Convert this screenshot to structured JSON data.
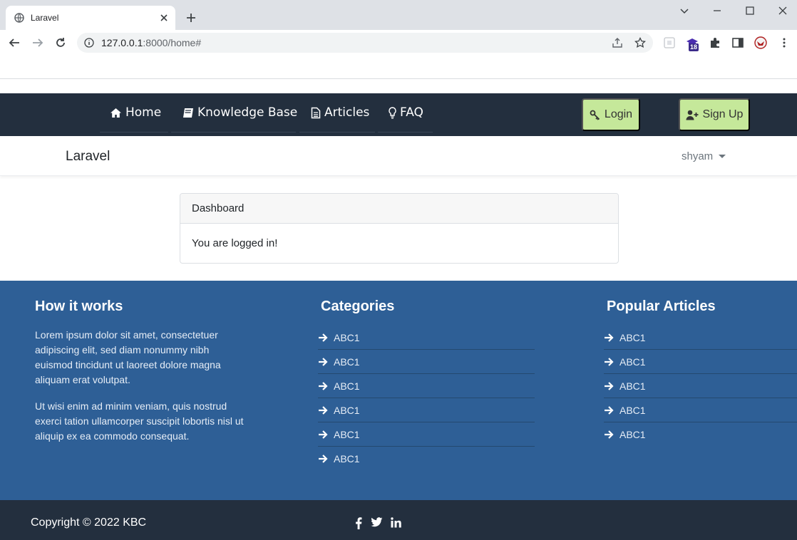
{
  "browser": {
    "tab_title": "Laravel",
    "url_host": "127.0.0.1",
    "url_rest": ":8000/home#",
    "extension_badge": "18"
  },
  "topnav": {
    "links": [
      {
        "label": "Home",
        "icon": "home-icon"
      },
      {
        "label": "Knowledge Base",
        "icon": "book-icon"
      },
      {
        "label": "Articles",
        "icon": "file-icon"
      },
      {
        "label": "FAQ",
        "icon": "lightbulb-icon"
      }
    ],
    "login_label": "Login",
    "signup_label": "Sign Up",
    "accent": "#c5e89a",
    "background": "#232f3e"
  },
  "appbar": {
    "brand": "Laravel",
    "user": "shyam"
  },
  "card": {
    "header": "Dashboard",
    "body": "You are logged in!"
  },
  "footer": {
    "background": "#2e5f96",
    "how": {
      "title": "How it works",
      "paragraphs": [
        "Lorem ipsum dolor sit amet, consectetuer adipiscing elit, sed diam nonummy nibh euismod tincidunt ut laoreet dolore magna aliquam erat volutpat.",
        "Ut wisi enim ad minim veniam, quis nostrud exerci tation ullamcorper suscipit lobortis nisl ut aliquip ex ea commodo consequat."
      ]
    },
    "categories": {
      "title": "Categories",
      "items": [
        "ABC1",
        "ABC1",
        "ABC1",
        "ABC1",
        "ABC1",
        "ABC1"
      ]
    },
    "popular": {
      "title": "Popular Articles",
      "items": [
        "ABC1",
        "ABC1",
        "ABC1",
        "ABC1",
        "ABC1"
      ]
    },
    "copyright": "Copyright © 2022 KBC",
    "social": [
      "facebook-icon",
      "twitter-icon",
      "linkedin-icon"
    ]
  }
}
